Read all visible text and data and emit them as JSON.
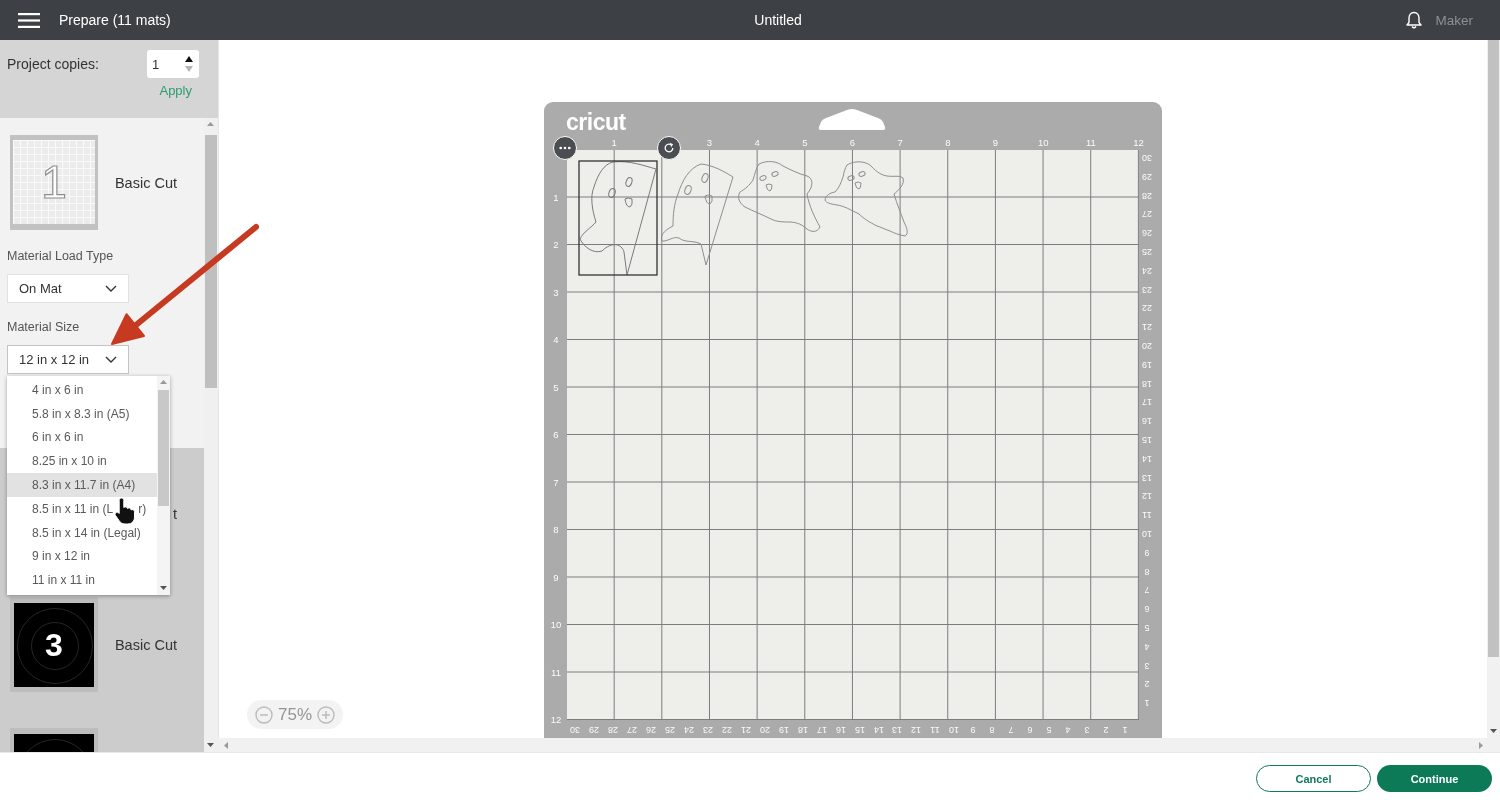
{
  "header": {
    "title": "Prepare (11 mats)",
    "document": "Untitled",
    "machine": "Maker"
  },
  "sidebar": {
    "copies": {
      "label": "Project copies:",
      "value": "1",
      "decrease_disabled": true,
      "apply": "Apply"
    },
    "mats": [
      {
        "kind": "light",
        "number": "1",
        "label": "Basic Cut",
        "selected": true,
        "settings": [
          {
            "label": "Material Load Type",
            "value": "On Mat",
            "open": false
          },
          {
            "label": "Material Size",
            "value": "12 in x 12 in",
            "open": true,
            "options": [
              {
                "label": "4 in x 6 in",
                "highlighted": false
              },
              {
                "label": "5.8 in x 8.3 in (A5)",
                "highlighted": false
              },
              {
                "label": "6 in x 6 in",
                "highlighted": false
              },
              {
                "label": "8.25 in x 10 in",
                "highlighted": false
              },
              {
                "label": "8.3 in x 11.7 in (A4)",
                "highlighted": true
              },
              {
                "label": "8.5 in x 11 in (L",
                "label_after": "r)",
                "highlighted": false
              },
              {
                "label": "8.5 in x 14 in (Legal)",
                "highlighted": false
              },
              {
                "label": "9 in x 12 in",
                "highlighted": false
              },
              {
                "label": "11 in x 11 in",
                "highlighted": false
              }
            ]
          }
        ]
      },
      {
        "label": "t",
        "selected": false
      },
      {
        "kind": "dark",
        "number": "3",
        "label": "Basic Cut",
        "selected": false
      },
      {
        "kind": "dark",
        "selected": false
      }
    ]
  },
  "mat": {
    "logo": "cricut",
    "top_ruler": [
      "1",
      "3",
      "4",
      "5",
      "6",
      "7",
      "8",
      "9",
      "10",
      "11",
      "12"
    ],
    "left_ruler": [
      "1",
      "2",
      "3",
      "4",
      "5",
      "6",
      "7",
      "8",
      "9",
      "10",
      "11",
      "12"
    ],
    "right_ruler": [
      "30",
      "29",
      "28",
      "27",
      "26",
      "25",
      "24",
      "23",
      "22",
      "21",
      "20",
      "19",
      "18",
      "17",
      "16",
      "15",
      "14",
      "13",
      "12",
      "11",
      "10",
      "9",
      "8",
      "7",
      "6",
      "5",
      "4",
      "3",
      "2",
      "1"
    ],
    "bottom_ruler": [
      "30",
      "29",
      "28",
      "27",
      "26",
      "25",
      "24",
      "23",
      "22",
      "21",
      "20",
      "19",
      "18",
      "17",
      "16",
      "15",
      "14",
      "13",
      "12",
      "11",
      "10",
      "9",
      "8",
      "7",
      "6",
      "5",
      "4",
      "3",
      "2",
      "1"
    ],
    "designs": [
      {
        "selected": true
      },
      {
        "selected": false
      },
      {
        "selected": false
      },
      {
        "selected": false
      }
    ]
  },
  "zoom": {
    "level": "75%"
  },
  "footer": {
    "buttons": [
      {
        "label": "Cancel",
        "kind": "secondary"
      },
      {
        "label": "Continue",
        "kind": "primary"
      }
    ]
  }
}
